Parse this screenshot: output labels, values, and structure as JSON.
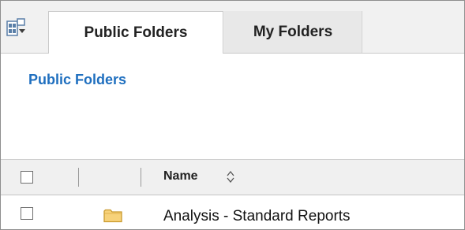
{
  "tabs": [
    {
      "label": "Public Folders",
      "active": true
    },
    {
      "label": "My Folders",
      "active": false
    }
  ],
  "icons": {
    "portal": "portal-view-icon",
    "sort": "sort-icon",
    "folder": "folder-icon"
  },
  "main": {
    "title": "Public Folders",
    "columns": [
      "Name"
    ],
    "rows": [
      {
        "name": "Analysis - Standard Reports",
        "type": "folder"
      }
    ]
  },
  "colors": {
    "link": "#1f6fbf",
    "folder": "#f3c766"
  }
}
